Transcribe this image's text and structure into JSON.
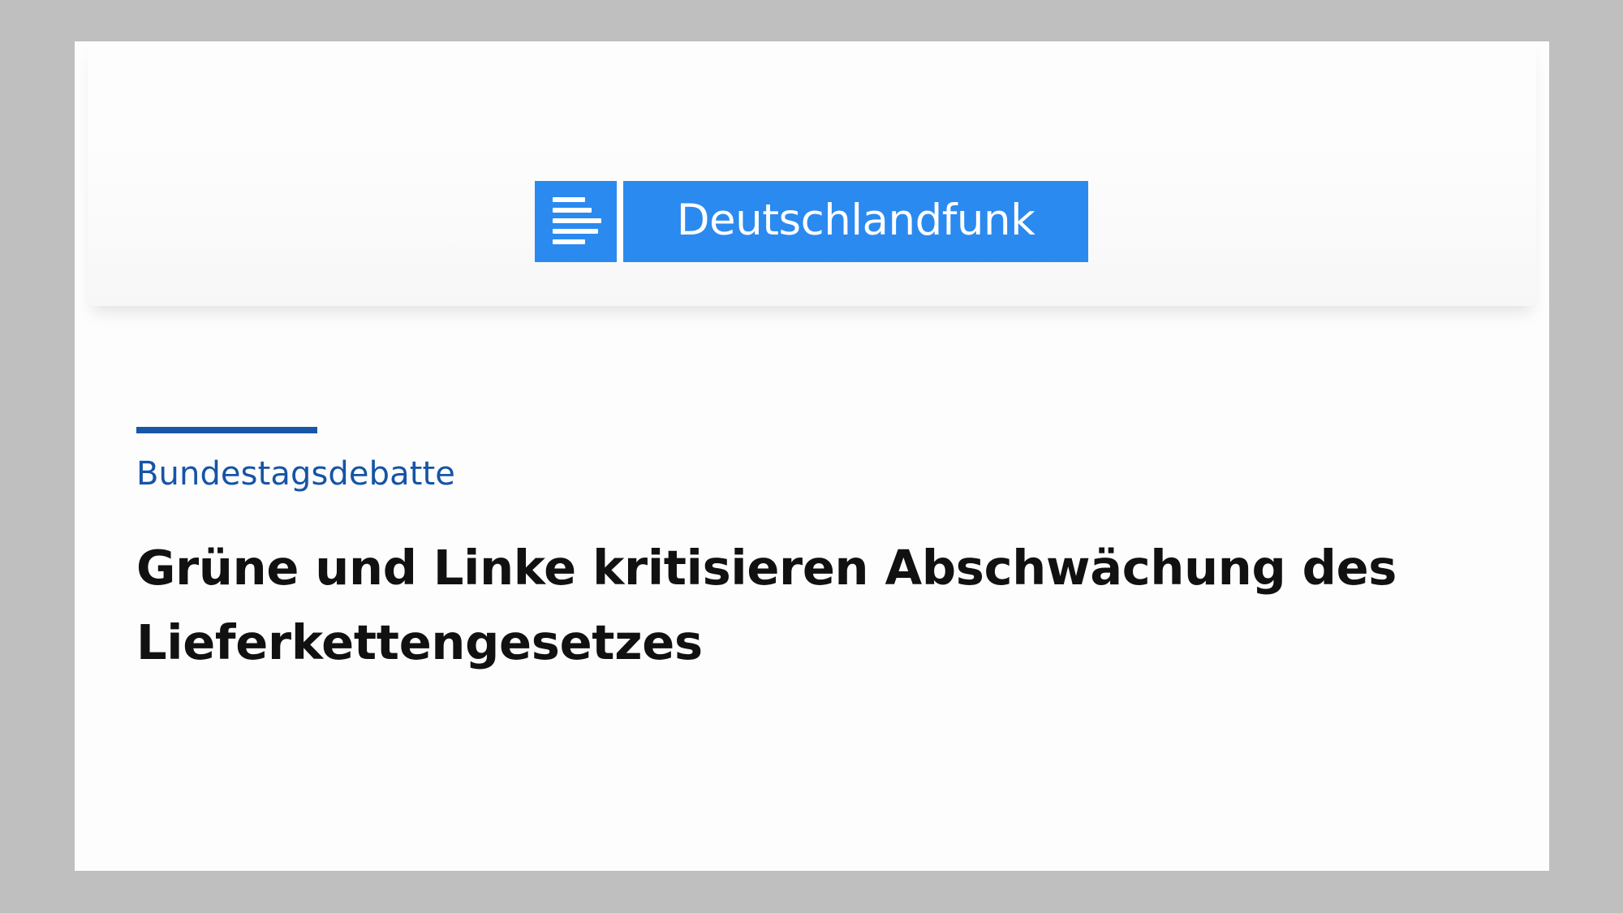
{
  "brand": {
    "name": "Deutschlandfunk",
    "color": "#2b8af0",
    "icon": "station-logo-icon"
  },
  "article": {
    "kicker": "Bundestagsdebatte",
    "headline": "Grüne und Linke kritisieren Abschwächung des Lieferkettengesetzes",
    "accent_color": "#1757a8"
  }
}
